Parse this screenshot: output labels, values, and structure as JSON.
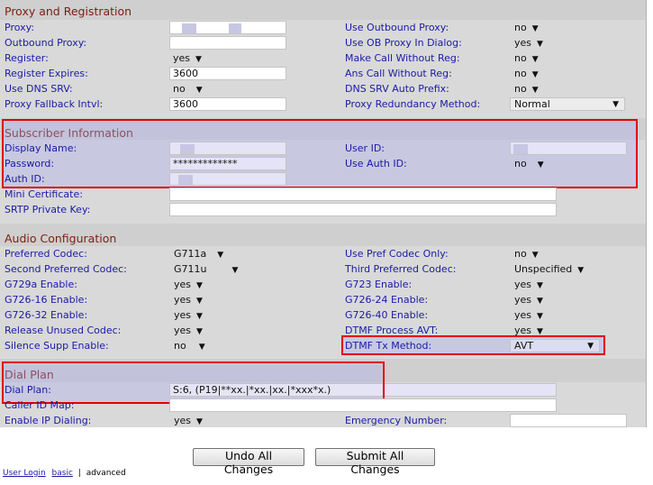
{
  "sections": {
    "proxy": "Proxy and Registration",
    "subscriber": "Subscriber Information",
    "audio": "Audio Configuration",
    "dialplan": "Dial Plan"
  },
  "proxy": {
    "proxy_label": "Proxy:",
    "proxy_value": "",
    "use_outbound_proxy_label": "Use Outbound Proxy:",
    "use_outbound_proxy_value": "no",
    "outbound_proxy_label": "Outbound Proxy:",
    "outbound_proxy_value": "",
    "use_ob_proxy_dialog_label": "Use OB Proxy In Dialog:",
    "use_ob_proxy_dialog_value": "yes",
    "register_label": "Register:",
    "register_value": "yes",
    "make_call_without_reg_label": "Make Call Without Reg:",
    "make_call_without_reg_value": "no",
    "register_expires_label": "Register Expires:",
    "register_expires_value": "3600",
    "ans_call_without_reg_label": "Ans Call Without Reg:",
    "ans_call_without_reg_value": "no",
    "use_dns_srv_label": "Use DNS SRV:",
    "use_dns_srv_value": "no",
    "dns_srv_auto_prefix_label": "DNS SRV Auto Prefix:",
    "dns_srv_auto_prefix_value": "no",
    "proxy_fallback_label": "Proxy Fallback Intvl:",
    "proxy_fallback_value": "3600",
    "proxy_redundancy_label": "Proxy Redundancy Method:",
    "proxy_redundancy_value": "Normal"
  },
  "subscriber": {
    "display_name_label": "Display Name:",
    "display_name_value": "",
    "user_id_label": "User ID:",
    "user_id_value": "",
    "password_label": "Password:",
    "password_value": "*************",
    "use_auth_id_label": "Use Auth ID:",
    "use_auth_id_value": "no",
    "auth_id_label": "Auth ID:",
    "auth_id_value": "",
    "mini_certificate_label": "Mini Certificate:",
    "mini_certificate_value": "",
    "srtp_key_label": "SRTP Private Key:",
    "srtp_key_value": ""
  },
  "audio": {
    "preferred_codec_label": "Preferred Codec:",
    "preferred_codec_value": "G711a",
    "use_pref_codec_only_label": "Use Pref Codec Only:",
    "use_pref_codec_only_value": "no",
    "second_codec_label": "Second Preferred Codec:",
    "second_codec_value": "G711u",
    "third_codec_label": "Third Preferred Codec:",
    "third_codec_value": "Unspecified",
    "g729a_label": "G729a Enable:",
    "g729a_value": "yes",
    "g723_label": "G723 Enable:",
    "g723_value": "yes",
    "g726_16_label": "G726-16 Enable:",
    "g726_16_value": "yes",
    "g726_24_label": "G726-24 Enable:",
    "g726_24_value": "yes",
    "g726_32_label": "G726-32 Enable:",
    "g726_32_value": "yes",
    "g726_40_label": "G726-40 Enable:",
    "g726_40_value": "yes",
    "release_unused_label": "Release Unused Codec:",
    "release_unused_value": "yes",
    "dtmf_process_avt_label": "DTMF Process AVT:",
    "dtmf_process_avt_value": "yes",
    "silence_supp_label": "Silence Supp Enable:",
    "silence_supp_value": "no",
    "dtmf_tx_method_label": "DTMF Tx Method:",
    "dtmf_tx_method_value": "AVT"
  },
  "dialplan": {
    "dial_plan_label": "Dial Plan:",
    "dial_plan_value": "S:6, (P19|**xx.|*xx.|xx.|*xxx*x.)",
    "caller_id_map_label": "Caller ID Map:",
    "caller_id_map_value": "",
    "enable_ip_dialing_label": "Enable IP Dialing:",
    "enable_ip_dialing_value": "yes",
    "emergency_number_label": "Emergency Number:",
    "emergency_number_value": ""
  },
  "buttons": {
    "undo": "Undo All Changes",
    "submit": "Submit All Changes"
  },
  "footer": {
    "user_login": "User Login",
    "basic": "basic",
    "separator": "|",
    "advanced": "advanced"
  },
  "colors": {
    "highlight": "#e00000",
    "section_title": "#7a1f12",
    "label": "#1a1aa6"
  }
}
